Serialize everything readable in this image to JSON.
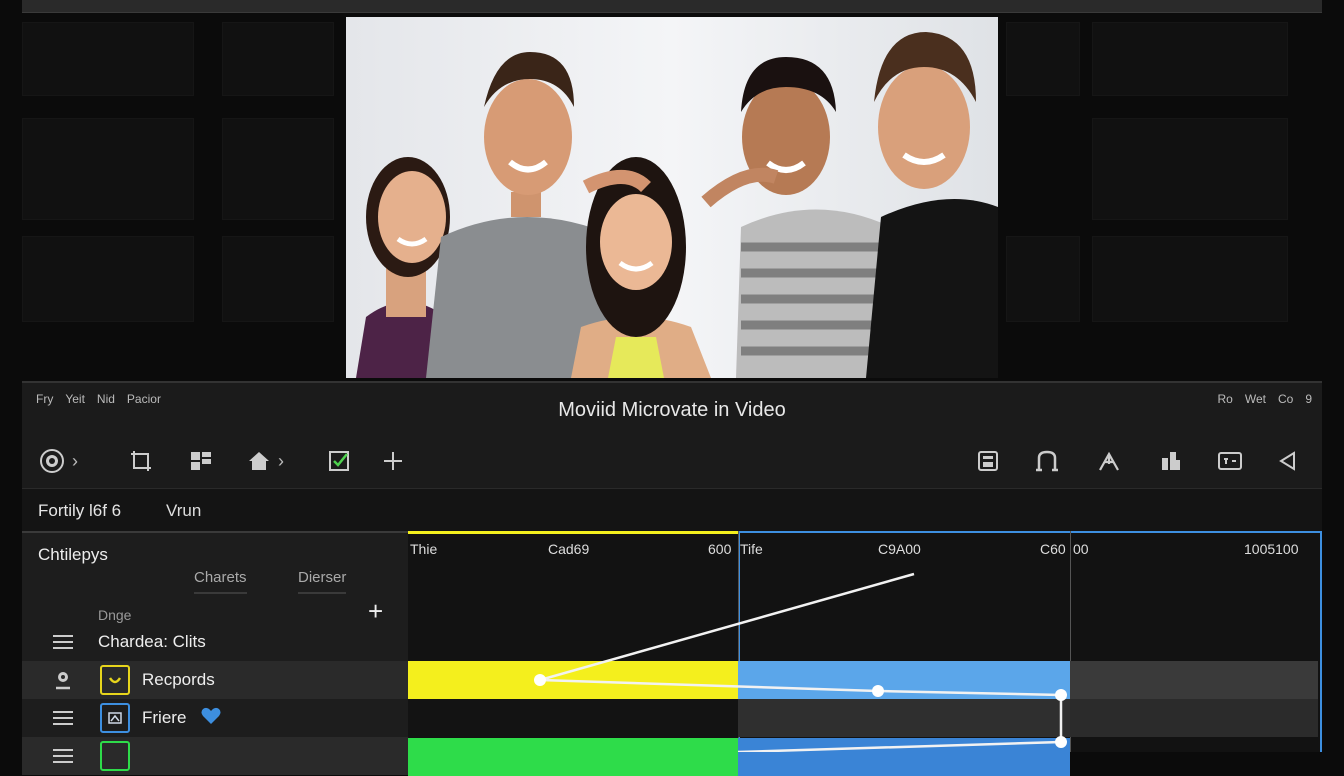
{
  "editor": {
    "menus": [
      "Fry",
      "Yeit",
      "Nid",
      "Pacior"
    ],
    "title": "Moviid Microvate in Video",
    "right_menus": [
      "Ro",
      "Wet",
      "Co",
      "9"
    ]
  },
  "toolbar": {
    "left_icons": [
      "record-icon",
      "crop-icon",
      "layout-icon",
      "home-icon",
      "edit-check-icon",
      "add-icon"
    ],
    "right_icons": [
      "save-icon",
      "magnet-icon",
      "split-icon",
      "bar-icon",
      "caption-icon",
      "back-icon"
    ]
  },
  "infobar": {
    "position": "Fortily l6f 6",
    "view": "Vrun"
  },
  "timeline": {
    "header_title": "Chtilepys",
    "subtabs": [
      "Charets",
      "Dierser"
    ],
    "group_label": "Dnge",
    "add_label": "+",
    "tracks": [
      {
        "name": "Chardea: Clits"
      },
      {
        "name": "Recpords"
      },
      {
        "name": "Friere"
      }
    ],
    "ruler": [
      "Thie",
      "Cad69",
      "600",
      "Tife",
      "C9A00",
      "C60",
      "00",
      "1005100"
    ],
    "colors": {
      "yellow": "#f4ef1d",
      "blue": "#5ba6ea",
      "green": "#2edc4a",
      "accent_blue": "#3d8fe0"
    }
  }
}
